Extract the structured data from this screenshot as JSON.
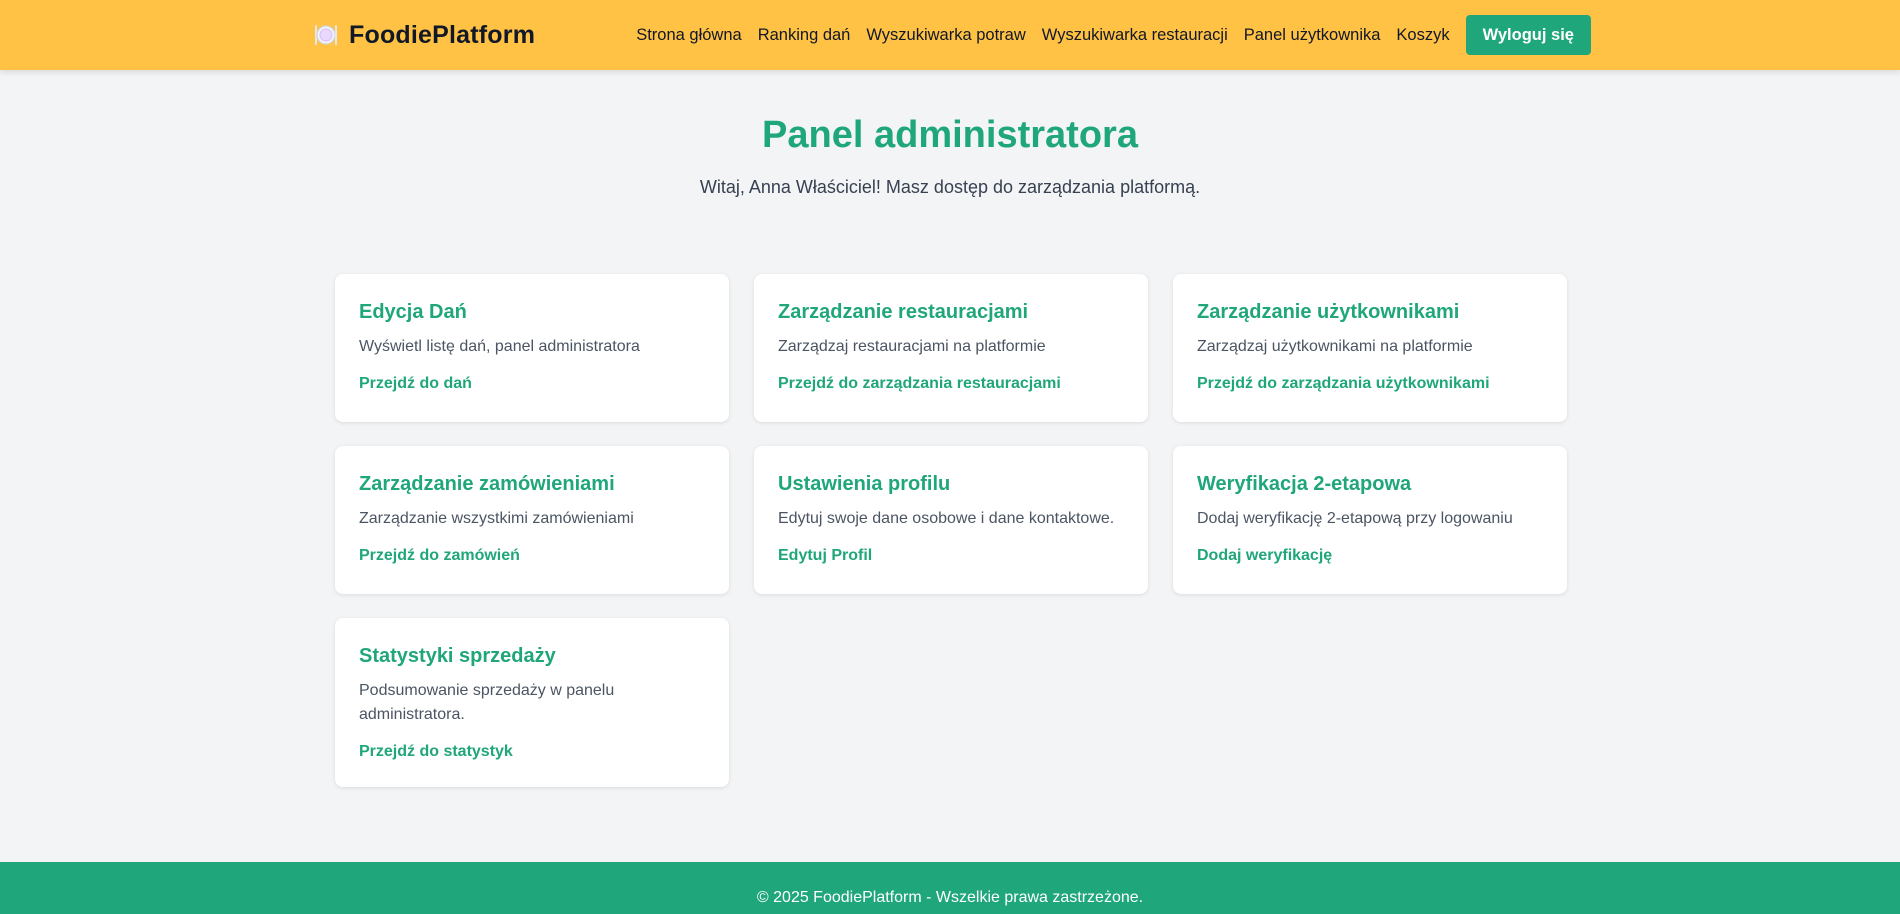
{
  "header": {
    "brand_icon": "plate-icon",
    "brand_title": "FoodiePlatform",
    "nav": [
      {
        "label": "Strona główna"
      },
      {
        "label": "Ranking dań"
      },
      {
        "label": "Wyszukiwarka potraw"
      },
      {
        "label": "Wyszukiwarka restauracji"
      },
      {
        "label": "Panel użytkownika"
      },
      {
        "label": "Koszyk"
      }
    ],
    "logout_label": "Wyloguj się"
  },
  "main": {
    "title": "Panel administratora",
    "subtitle": "Witaj, Anna Właściciel! Masz dostęp do zarządzania platformą."
  },
  "cards": [
    {
      "title": "Edycja Dań",
      "description": "Wyświetl listę dań, panel administratora",
      "link": "Przejdź do dań"
    },
    {
      "title": "Zarządzanie restauracjami",
      "description": "Zarządzaj restauracjami na platformie",
      "link": "Przejdź do zarządzania restauracjami"
    },
    {
      "title": "Zarządzanie użytkownikami",
      "description": "Zarządzaj użytkownikami na platformie",
      "link": "Przejdź do zarządzania użytkownikami"
    },
    {
      "title": "Zarządzanie zamówieniami",
      "description": "Zarządzanie wszystkimi zamówieniami",
      "link": "Przejdź do zamówień"
    },
    {
      "title": "Ustawienia profilu",
      "description": "Edytuj swoje dane osobowe i dane kontaktowe.",
      "link": "Edytuj Profil"
    },
    {
      "title": "Weryfikacja 2-etapowa",
      "description": "Dodaj weryfikację 2-etapową przy logowaniu",
      "link": "Dodaj weryfikację"
    },
    {
      "title": "Statystyki sprzedaży",
      "description": "Podsumowanie sprzedaży w panelu administratora.",
      "link": "Przejdź do statystyk"
    }
  ],
  "footer": {
    "text": "© 2025 FoodiePlatform - Wszelkie prawa zastrzeżone."
  },
  "colors": {
    "header_bg": "#ffc244",
    "accent": "#1fa67a",
    "page_bg": "#f3f4f6"
  }
}
